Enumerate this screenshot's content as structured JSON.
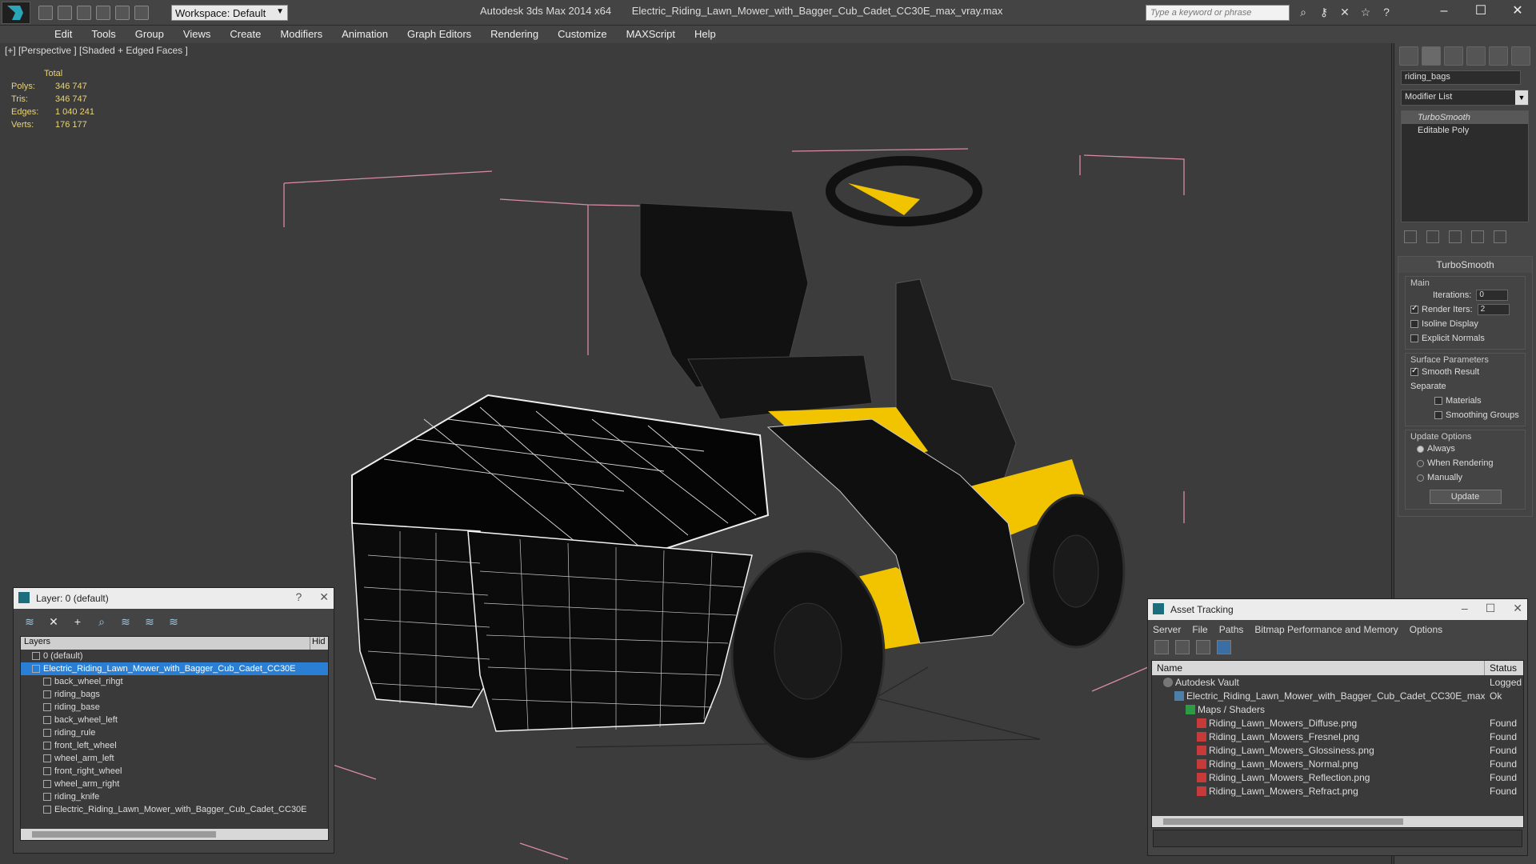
{
  "titlebar": {
    "workspace_label": "Workspace: Default",
    "app_name": "Autodesk 3ds Max  2014 x64",
    "file_name": "Electric_Riding_Lawn_Mower_with_Bagger_Cub_Cadet_CC30E_max_vray.max",
    "search_placeholder": "Type a keyword or phrase"
  },
  "menu": [
    "Edit",
    "Tools",
    "Group",
    "Views",
    "Create",
    "Modifiers",
    "Animation",
    "Graph Editors",
    "Rendering",
    "Customize",
    "MAXScript",
    "Help"
  ],
  "viewport": {
    "label": "[+] [Perspective ] [Shaded + Edged Faces ]",
    "stats": {
      "header": "Total",
      "rows": [
        {
          "k": "Polys:",
          "v": "346 747"
        },
        {
          "k": "Tris:",
          "v": "346 747"
        },
        {
          "k": "Edges:",
          "v": "1 040 241"
        },
        {
          "k": "Verts:",
          "v": "176 177"
        }
      ]
    }
  },
  "command_panel": {
    "object_name": "riding_bags",
    "modifier_list": "Modifier List",
    "stack": [
      "TurboSmooth",
      "Editable Poly"
    ],
    "rollout_title": "TurboSmooth",
    "main_label": "Main",
    "iterations_label": "Iterations:",
    "iterations_value": "0",
    "render_iters_label": "Render Iters:",
    "render_iters_value": "2",
    "isoline": "Isoline Display",
    "explicit_normals": "Explicit Normals",
    "surface_params": "Surface Parameters",
    "smooth_result": "Smooth Result",
    "separate": "Separate",
    "materials": "Materials",
    "smoothing_groups": "Smoothing Groups",
    "update_options": "Update Options",
    "always": "Always",
    "when_rendering": "When Rendering",
    "manually": "Manually",
    "update_button": "Update"
  },
  "layer_window": {
    "title": "Layer: 0 (default)",
    "col_layers": "Layers",
    "col_hide": "Hid",
    "rows": [
      {
        "label": "0 (default)",
        "indent": 1
      },
      {
        "label": "Electric_Riding_Lawn_Mower_with_Bagger_Cub_Cadet_CC30E",
        "indent": 1
      },
      {
        "label": "back_wheel_rihgt",
        "indent": 2
      },
      {
        "label": "riding_bags",
        "indent": 2
      },
      {
        "label": "riding_base",
        "indent": 2
      },
      {
        "label": "back_wheel_left",
        "indent": 2
      },
      {
        "label": "riding_rule",
        "indent": 2
      },
      {
        "label": "front_left_wheel",
        "indent": 2
      },
      {
        "label": "wheel_arm_left",
        "indent": 2
      },
      {
        "label": "front_right_wheel",
        "indent": 2
      },
      {
        "label": "wheel_arm_right",
        "indent": 2
      },
      {
        "label": "riding_knife",
        "indent": 2
      },
      {
        "label": "Electric_Riding_Lawn_Mower_with_Bagger_Cub_Cadet_CC30E",
        "indent": 2
      }
    ]
  },
  "asset_window": {
    "title": "Asset Tracking",
    "menu": [
      "Server",
      "File",
      "Paths",
      "Bitmap Performance and Memory",
      "Options"
    ],
    "col_name": "Name",
    "col_status": "Status",
    "rows": [
      {
        "name": "Autodesk Vault",
        "status": "Logged",
        "icon": "vault",
        "indent": 1
      },
      {
        "name": "Electric_Riding_Lawn_Mower_with_Bagger_Cub_Cadet_CC30E_max...",
        "status": "Ok",
        "icon": "max",
        "indent": 2
      },
      {
        "name": "Maps / Shaders",
        "status": "",
        "icon": "folder",
        "indent": 3
      },
      {
        "name": "Riding_Lawn_Mowers_Diffuse.png",
        "status": "Found",
        "icon": "png",
        "indent": 4
      },
      {
        "name": "Riding_Lawn_Mowers_Fresnel.png",
        "status": "Found",
        "icon": "png",
        "indent": 4
      },
      {
        "name": "Riding_Lawn_Mowers_Glossiness.png",
        "status": "Found",
        "icon": "png",
        "indent": 4
      },
      {
        "name": "Riding_Lawn_Mowers_Normal.png",
        "status": "Found",
        "icon": "png",
        "indent": 4
      },
      {
        "name": "Riding_Lawn_Mowers_Reflection.png",
        "status": "Found",
        "icon": "png",
        "indent": 4
      },
      {
        "name": "Riding_Lawn_Mowers_Refract.png",
        "status": "Found",
        "icon": "png",
        "indent": 4
      }
    ]
  }
}
